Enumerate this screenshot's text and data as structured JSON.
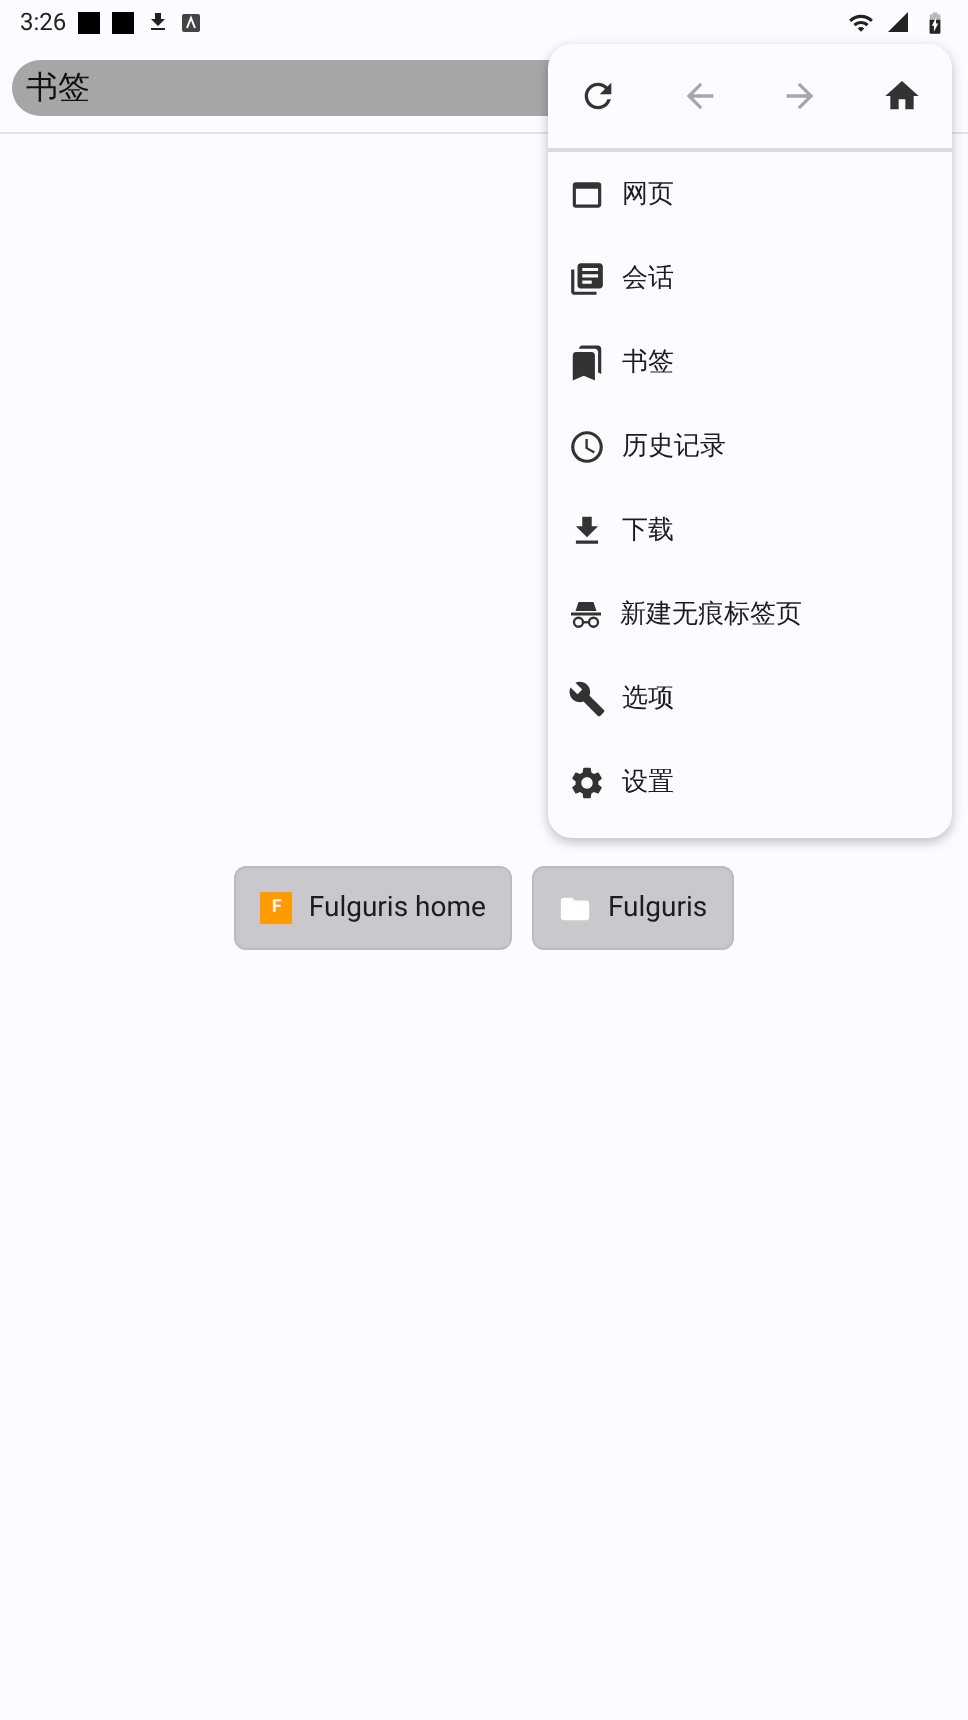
{
  "status_bar": {
    "time": "3:26"
  },
  "address_bar": {
    "value": "书签"
  },
  "menu": {
    "nav": [
      {
        "kind": "reload",
        "disabled": false
      },
      {
        "kind": "back",
        "disabled": true
      },
      {
        "kind": "forward",
        "disabled": true
      },
      {
        "kind": "home",
        "disabled": false
      }
    ],
    "items": [
      {
        "kind": "tabs",
        "label": "网页"
      },
      {
        "kind": "sessions",
        "label": "会话"
      },
      {
        "kind": "bookmarks",
        "label": "书签"
      },
      {
        "kind": "history",
        "label": "历史记录"
      },
      {
        "kind": "downloads",
        "label": "下载"
      },
      {
        "kind": "incognito",
        "label": "新建无痕标签页"
      },
      {
        "kind": "options",
        "label": "选项"
      },
      {
        "kind": "settings",
        "label": "设置"
      }
    ]
  },
  "bookmarks": [
    {
      "kind": "site",
      "label": "Fulguris home",
      "favicon_letter": "F"
    },
    {
      "kind": "folder",
      "label": "Fulguris"
    }
  ]
}
